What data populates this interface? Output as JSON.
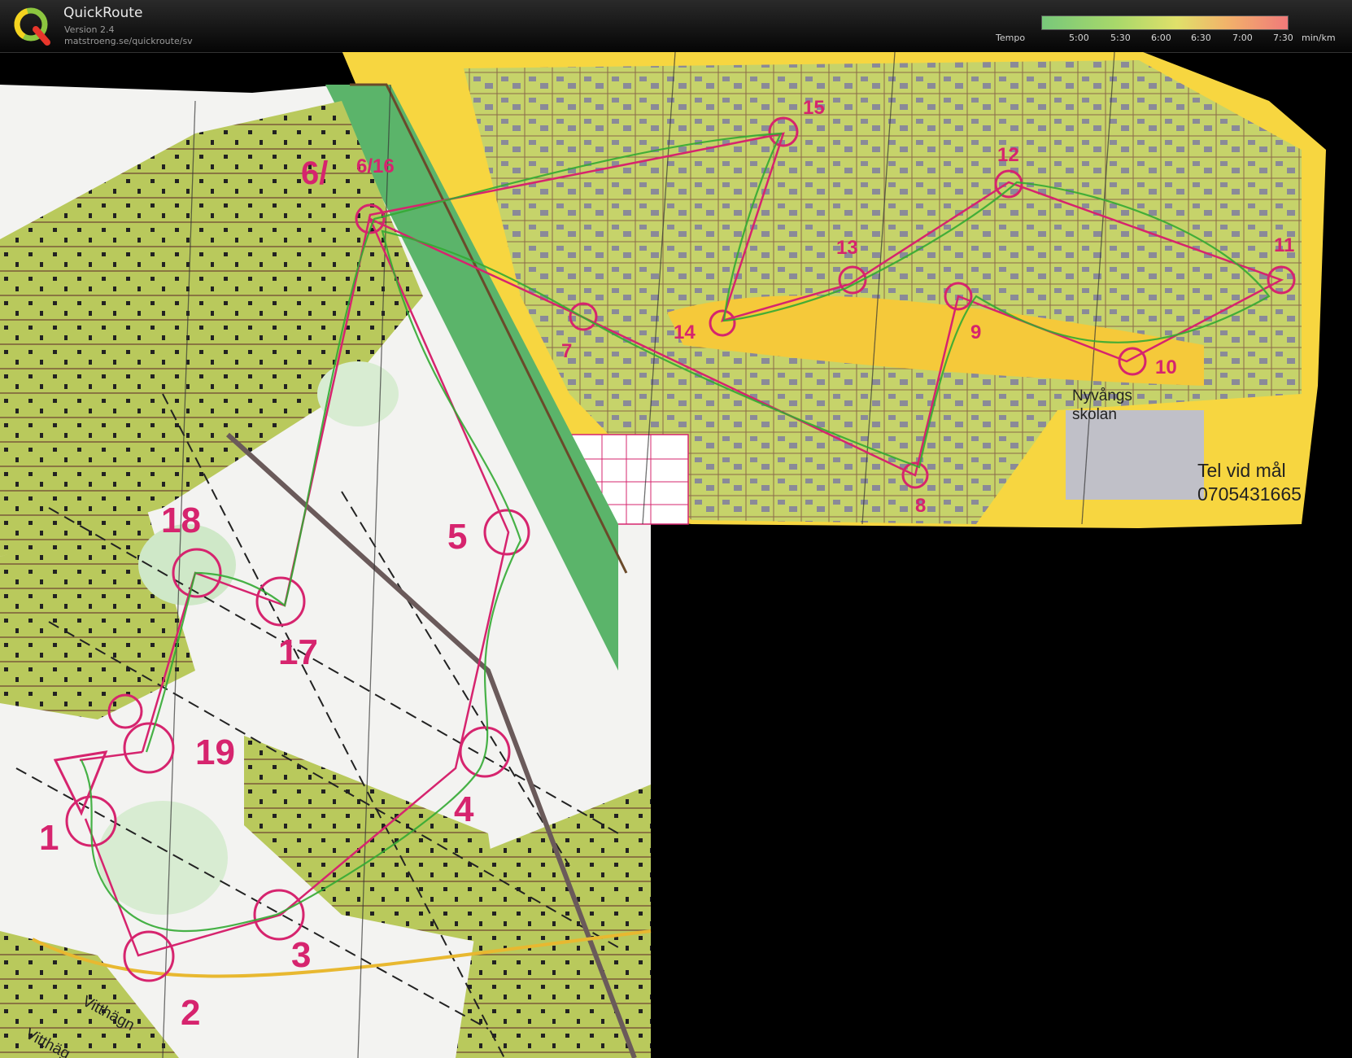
{
  "app": {
    "title": "QuickRoute",
    "version": "Version 2.4",
    "url": "matstroeng.se/quickroute/sv",
    "logo_letter": "Q"
  },
  "tempo": {
    "label": "Tempo",
    "ticks": [
      "5:00",
      "5:30",
      "6:00",
      "6:30",
      "7:00",
      "7:30"
    ],
    "unit": "min/km"
  },
  "map": {
    "controls": [
      "1",
      "2",
      "3",
      "4",
      "5",
      "6/",
      "6/16",
      "7",
      "8",
      "9",
      "10",
      "11",
      "12",
      "13",
      "14",
      "15",
      "17",
      "18",
      "19"
    ],
    "place_label_line1": "Nyvångs",
    "place_label_line2": "skolan",
    "phone_label": "Tel vid mål",
    "phone_number": "0705431665",
    "road_label_1": "Vitthägn",
    "road_label_2": "Vitthäg",
    "colors": {
      "course": "#d6246e",
      "open": "#f5c93a",
      "forest_green": "#c8d86a",
      "paper": "#f4f4f2"
    }
  }
}
